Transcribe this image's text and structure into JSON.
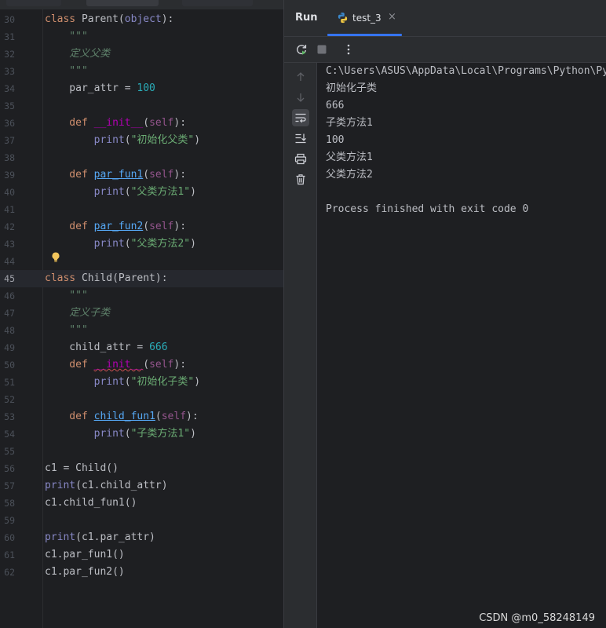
{
  "editor": {
    "lines": [
      {
        "n": "30",
        "caret": false,
        "t": [
          {
            "c": "kw",
            "s": "class "
          },
          {
            "c": "",
            "s": "Parent("
          },
          {
            "c": "builtin",
            "s": "object"
          },
          {
            "c": "",
            "s": "):"
          }
        ]
      },
      {
        "n": "31",
        "caret": false,
        "t": [
          {
            "c": "doc",
            "s": "    \"\"\""
          }
        ]
      },
      {
        "n": "32",
        "caret": false,
        "t": [
          {
            "c": "docc",
            "s": "    定义父类"
          }
        ]
      },
      {
        "n": "33",
        "caret": false,
        "t": [
          {
            "c": "doc",
            "s": "    \"\"\""
          }
        ]
      },
      {
        "n": "34",
        "caret": false,
        "t": [
          {
            "c": "",
            "s": "    par_attr = "
          },
          {
            "c": "num",
            "s": "100"
          }
        ]
      },
      {
        "n": "35",
        "caret": false,
        "t": []
      },
      {
        "n": "36",
        "caret": false,
        "t": [
          {
            "c": "kw",
            "s": "    def "
          },
          {
            "c": "dunder",
            "s": "__init__"
          },
          {
            "c": "",
            "s": "("
          },
          {
            "c": "self",
            "s": "self"
          },
          {
            "c": "",
            "s": "):"
          }
        ]
      },
      {
        "n": "37",
        "caret": false,
        "t": [
          {
            "c": "builtin",
            "s": "        print"
          },
          {
            "c": "",
            "s": "("
          },
          {
            "c": "str",
            "s": "\"初始化父类\""
          },
          {
            "c": "",
            "s": ")"
          }
        ]
      },
      {
        "n": "38",
        "caret": false,
        "t": []
      },
      {
        "n": "39",
        "caret": false,
        "t": [
          {
            "c": "kw",
            "s": "    def "
          },
          {
            "c": "fn fnu",
            "s": "par_fun1"
          },
          {
            "c": "",
            "s": "("
          },
          {
            "c": "self",
            "s": "self"
          },
          {
            "c": "",
            "s": "):"
          }
        ]
      },
      {
        "n": "40",
        "caret": false,
        "t": [
          {
            "c": "builtin",
            "s": "        print"
          },
          {
            "c": "",
            "s": "("
          },
          {
            "c": "str",
            "s": "\"父类方法1\""
          },
          {
            "c": "",
            "s": ")"
          }
        ]
      },
      {
        "n": "41",
        "caret": false,
        "t": []
      },
      {
        "n": "42",
        "caret": false,
        "t": [
          {
            "c": "kw",
            "s": "    def "
          },
          {
            "c": "fn fnu",
            "s": "par_fun2"
          },
          {
            "c": "",
            "s": "("
          },
          {
            "c": "self",
            "s": "self"
          },
          {
            "c": "",
            "s": "):"
          }
        ]
      },
      {
        "n": "43",
        "caret": false,
        "t": [
          {
            "c": "builtin",
            "s": "        print"
          },
          {
            "c": "",
            "s": "("
          },
          {
            "c": "str",
            "s": "\"父类方法2\""
          },
          {
            "c": "",
            "s": ")"
          }
        ]
      },
      {
        "n": "44",
        "caret": false,
        "t": []
      },
      {
        "n": "45",
        "caret": true,
        "t": [
          {
            "c": "kw",
            "s": "class "
          },
          {
            "c": "",
            "s": "Child(Parent):"
          }
        ]
      },
      {
        "n": "46",
        "caret": false,
        "t": [
          {
            "c": "doc",
            "s": "    \"\"\""
          }
        ]
      },
      {
        "n": "47",
        "caret": false,
        "t": [
          {
            "c": "docc",
            "s": "    定义子类"
          }
        ]
      },
      {
        "n": "48",
        "caret": false,
        "t": [
          {
            "c": "doc",
            "s": "    \"\"\""
          }
        ]
      },
      {
        "n": "49",
        "caret": false,
        "t": [
          {
            "c": "",
            "s": "    child_attr = "
          },
          {
            "c": "num",
            "s": "666"
          }
        ]
      },
      {
        "n": "50",
        "caret": false,
        "t": [
          {
            "c": "kw",
            "s": "    def "
          },
          {
            "c": "dunder squig",
            "s": "__init__"
          },
          {
            "c": "",
            "s": "("
          },
          {
            "c": "self",
            "s": "self"
          },
          {
            "c": "",
            "s": "):"
          }
        ]
      },
      {
        "n": "51",
        "caret": false,
        "t": [
          {
            "c": "builtin",
            "s": "        print"
          },
          {
            "c": "",
            "s": "("
          },
          {
            "c": "str",
            "s": "\"初始化子类\""
          },
          {
            "c": "",
            "s": ")"
          }
        ]
      },
      {
        "n": "52",
        "caret": false,
        "t": []
      },
      {
        "n": "53",
        "caret": false,
        "t": [
          {
            "c": "kw",
            "s": "    def "
          },
          {
            "c": "fn fnu",
            "s": "child_fun1"
          },
          {
            "c": "",
            "s": "("
          },
          {
            "c": "self",
            "s": "self"
          },
          {
            "c": "",
            "s": "):"
          }
        ]
      },
      {
        "n": "54",
        "caret": false,
        "t": [
          {
            "c": "builtin",
            "s": "        print"
          },
          {
            "c": "",
            "s": "("
          },
          {
            "c": "str",
            "s": "\"子类方法1\""
          },
          {
            "c": "",
            "s": ")"
          }
        ]
      },
      {
        "n": "55",
        "caret": false,
        "t": []
      },
      {
        "n": "56",
        "caret": false,
        "t": [
          {
            "c": "",
            "s": "c1 = Child()"
          }
        ]
      },
      {
        "n": "57",
        "caret": false,
        "t": [
          {
            "c": "builtin",
            "s": "print"
          },
          {
            "c": "",
            "s": "(c1.child_attr)"
          }
        ]
      },
      {
        "n": "58",
        "caret": false,
        "t": [
          {
            "c": "",
            "s": "c1.child_fun1()"
          }
        ]
      },
      {
        "n": "59",
        "caret": false,
        "t": []
      },
      {
        "n": "60",
        "caret": false,
        "t": [
          {
            "c": "builtin",
            "s": "print"
          },
          {
            "c": "",
            "s": "(c1.par_attr)"
          }
        ]
      },
      {
        "n": "61",
        "caret": false,
        "t": [
          {
            "c": "",
            "s": "c1.par_fun1()"
          }
        ]
      },
      {
        "n": "62",
        "caret": false,
        "t": [
          {
            "c": "",
            "s": "c1.par_fun2()"
          }
        ]
      }
    ],
    "bulb_icon": "lightbulb-icon"
  },
  "run": {
    "title": "Run",
    "tab_label": "test_3",
    "tab_close": "×",
    "tab_icon": "python-file-icon",
    "toolbar": {
      "rerun_icon": "rerun-icon",
      "stop_icon": "stop-icon",
      "more_icon": "more-vertical-icon"
    },
    "side_icons": [
      "arrow-up-icon",
      "arrow-down-icon",
      "soft-wrap-icon",
      "scroll-to-end-icon",
      "print-icon",
      "trash-icon"
    ],
    "output": [
      "C:\\Users\\ASUS\\AppData\\Local\\Programs\\Python\\Py",
      "初始化子类",
      "666",
      "子类方法1",
      "100",
      "父类方法1",
      "父类方法2",
      "",
      "Process finished with exit code 0"
    ]
  },
  "watermark": "CSDN @m0_58248149",
  "colors": {
    "accent": "#3574f0",
    "background": "#1e1f22",
    "panel": "#2b2d30"
  }
}
